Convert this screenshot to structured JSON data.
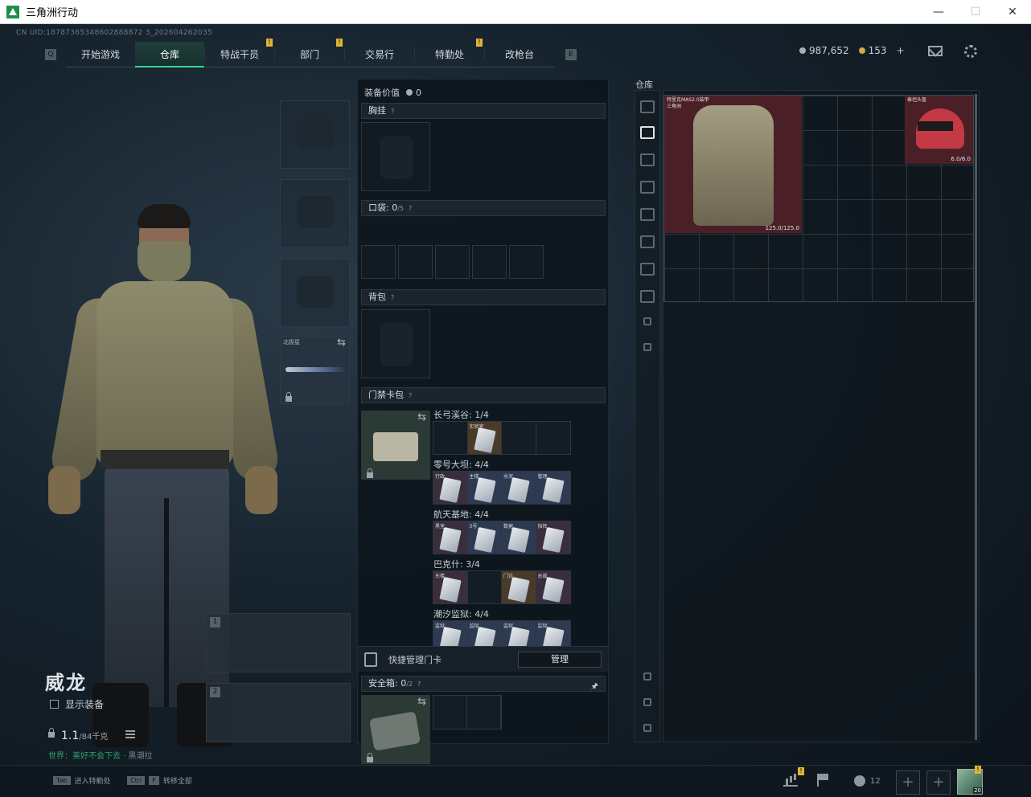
{
  "window": {
    "title": "三角洲行动",
    "min": "—",
    "max": "☐",
    "close": "✕"
  },
  "uid": "CN UID:18787365348602888872 3_202604262035",
  "nav": {
    "left_key": "Q",
    "right_key": "E",
    "tabs": [
      {
        "label": "开始游戏",
        "badge": ""
      },
      {
        "label": "仓库",
        "badge": "",
        "active": true
      },
      {
        "label": "特战干员",
        "badge": "!"
      },
      {
        "label": "部门",
        "badge": "!"
      },
      {
        "label": "交易行",
        "badge": ""
      },
      {
        "label": "特勤处",
        "badge": "!"
      },
      {
        "label": "改枪台",
        "badge": ""
      }
    ]
  },
  "currency": {
    "silver": "987,652",
    "gold": "153",
    "plus": "+"
  },
  "character": {
    "name": "威龙",
    "show_gear": "显示装备",
    "weight": "1.1",
    "weight_max": "/84千克",
    "status_green": "世界：美好不会下去",
    "status_rest": "· 黑潮拉"
  },
  "equip": {
    "melee_label": "北极星",
    "weapon1": "1",
    "weapon2": "2"
  },
  "mid": {
    "value_label": "装备价值",
    "value": "0",
    "chest_rig": "胸挂",
    "pocket": "口袋:",
    "pocket_count": "0",
    "pocket_max": "/5",
    "backpack": "背包",
    "card_case": "门禁卡包",
    "q": "?",
    "maps": [
      {
        "label": "长弓溪谷: 1/4",
        "cards": [
          {
            "name": "",
            "filled": false
          },
          {
            "name": "实验室",
            "filled": true,
            "tone": "gold"
          },
          {
            "name": "",
            "filled": false
          },
          {
            "name": "",
            "filled": false
          }
        ]
      },
      {
        "label": "零号大坝: 4/4",
        "cards": [
          {
            "name": "行政",
            "filled": true,
            "tone": ""
          },
          {
            "name": "主楼",
            "filled": true,
            "tone": "blue"
          },
          {
            "name": "水泥",
            "filled": true,
            "tone": "blue"
          },
          {
            "name": "管理",
            "filled": true,
            "tone": "blue"
          }
        ]
      },
      {
        "label": "航天基地: 4/4",
        "cards": [
          {
            "name": "黑室",
            "filled": true,
            "tone": ""
          },
          {
            "name": "3号",
            "filled": true,
            "tone": "blue"
          },
          {
            "name": "数据",
            "filled": true,
            "tone": "blue"
          },
          {
            "name": "指挥",
            "filled": true,
            "tone": ""
          }
        ]
      },
      {
        "label": "巴克什: 3/4",
        "cards": [
          {
            "name": "东楼",
            "filled": true,
            "tone": ""
          },
          {
            "name": "",
            "filled": false
          },
          {
            "name": "门诊",
            "filled": true,
            "tone": "gold"
          },
          {
            "name": "总裁",
            "filled": true,
            "tone": ""
          }
        ]
      },
      {
        "label": "潮汐监狱: 4/4",
        "cards": [
          {
            "name": "监狱",
            "filled": true,
            "tone": "blue"
          },
          {
            "name": "监狱",
            "filled": true,
            "tone": "blue"
          },
          {
            "name": "监狱",
            "filled": true,
            "tone": "blue"
          },
          {
            "name": "监狱",
            "filled": true,
            "tone": "blue"
          }
        ]
      }
    ],
    "quick_manage": "快捷管理门卡",
    "manage_btn": "管理",
    "safe_box": "安全箱:",
    "safe_count": "0",
    "safe_max": "/2",
    "pin": "🖈"
  },
  "warehouse": {
    "label": "仓库",
    "armor_name": "特里克MAS2.0装甲\n三角洲",
    "armor_dur": "125.0/125.0",
    "helmet_name": "泰坦头盔",
    "helmet_dur": "6.0/6.0"
  },
  "bottom": {
    "hint1_key": "Tab",
    "hint1": "进入特勤处",
    "hint2_key": "Ctrl",
    "hint2_key2": "F",
    "hint2": "转移全部",
    "friends": "12",
    "add": "+",
    "level": "20"
  },
  "colors": {
    "accent": "#39d29a",
    "badge": "#e0b534",
    "item_bg": "#4a2026"
  }
}
